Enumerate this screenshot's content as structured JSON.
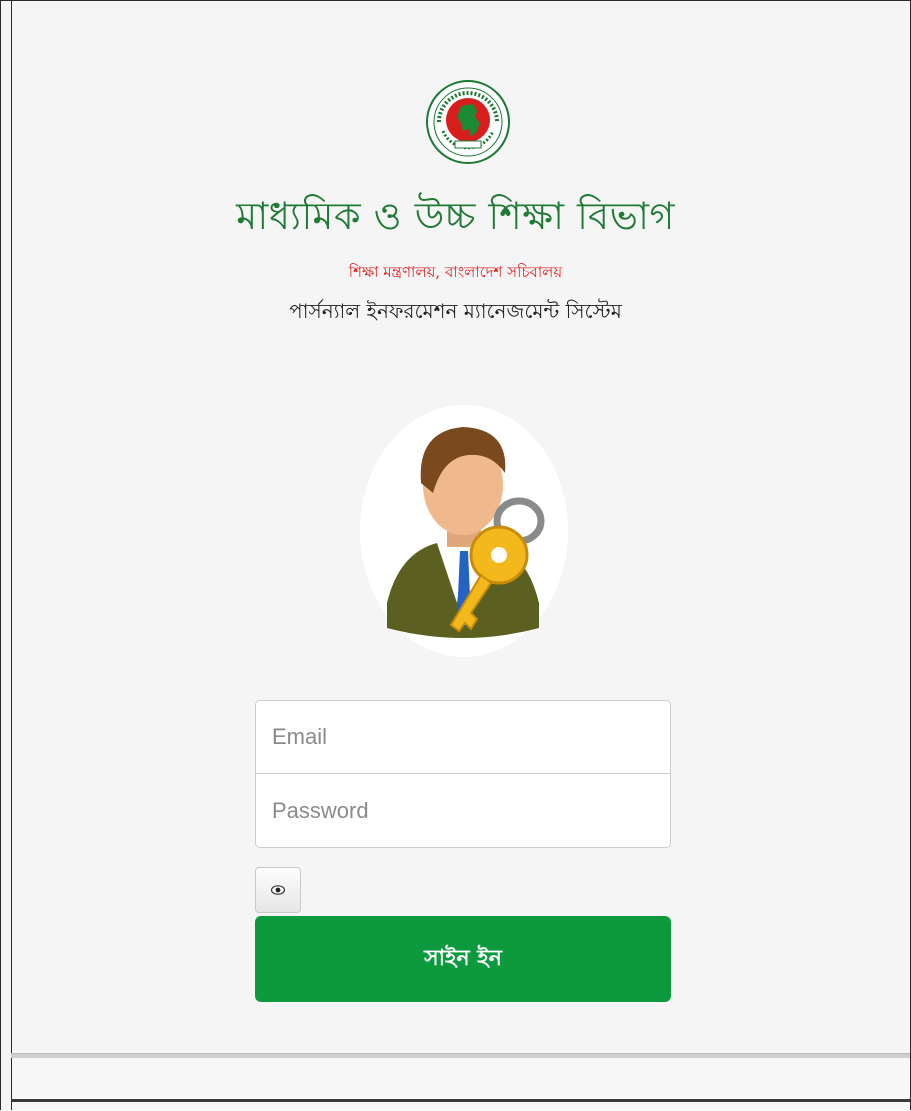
{
  "header": {
    "department": "মাধ্যমিক ও উচ্চ শিক্ষা বিভাগ",
    "ministry": "শিক্ষা মন্ত্রণালয়, বাংলাদেশ সচিবালয়",
    "system_name": "পার্সন্যাল ইনফরমেশন ম্যানেজমেন্ট সিস্টেম"
  },
  "icons": {
    "emblem": "bangladesh-govt-emblem-icon",
    "avatar": "user-with-key-icon",
    "eye": "eye-icon"
  },
  "form": {
    "email": {
      "value": "",
      "placeholder": "Email"
    },
    "password": {
      "value": "",
      "placeholder": "Password"
    },
    "signin_label": "সাইন ইন"
  },
  "colors": {
    "title_green": "#1f7a34",
    "ministry_red": "#e21b1b",
    "button_green": "#0d9a3f"
  }
}
